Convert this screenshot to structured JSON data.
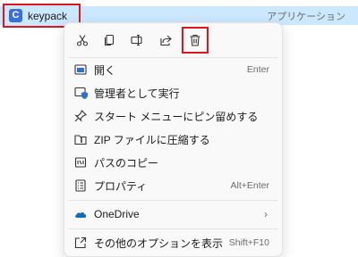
{
  "file": {
    "name": "keypack",
    "type": "アプリケーション",
    "icon": "app-icon"
  },
  "toolbar": {
    "cut": "cut-icon",
    "copy": "copy-icon",
    "rename": "rename-icon",
    "share": "share-icon",
    "delete": "delete-icon"
  },
  "menu": {
    "open": {
      "label": "開く",
      "shortcut": "Enter"
    },
    "run_as_admin": {
      "label": "管理者として実行"
    },
    "pin_start": {
      "label": "スタート メニューにピン留めする"
    },
    "zip": {
      "label": "ZIP ファイルに圧縮する"
    },
    "copy_path": {
      "label": "パスのコピー"
    },
    "properties": {
      "label": "プロパティ",
      "shortcut": "Alt+Enter"
    },
    "onedrive": {
      "label": "OneDrive",
      "chevron": "›"
    },
    "more_options": {
      "label": "その他のオプションを表示",
      "shortcut": "Shift+F10"
    }
  },
  "colors": {
    "highlight": "#e0161f",
    "selection": "#cce8ff",
    "accent": "#0067c0"
  }
}
